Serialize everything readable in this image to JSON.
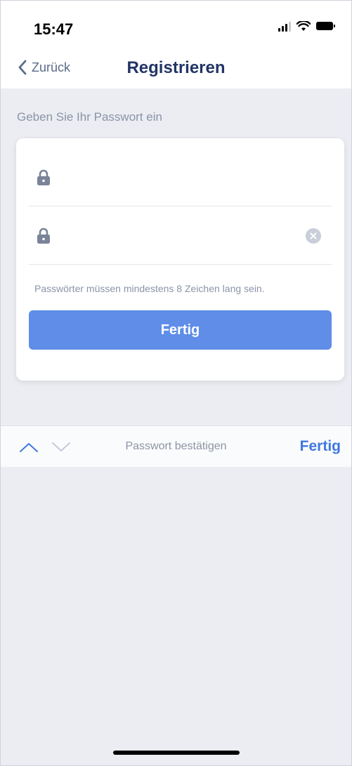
{
  "status_bar": {
    "time": "15:47"
  },
  "nav": {
    "back_label": "Zurück",
    "title": "Registrieren"
  },
  "form": {
    "section_label": "Geben Sie Ihr Passwort ein",
    "password_placeholder": "",
    "confirm_placeholder": "",
    "hint": "Passwörter müssen mindestens 8 Zeichen lang sein.",
    "submit_label": "Fertig"
  },
  "keyboard_accessory": {
    "title": "Passwort bestätigen",
    "done_label": "Fertig"
  },
  "colors": {
    "primary": "#5f8de8",
    "accent_link": "#3e78e0",
    "background": "#ebedf2",
    "title": "#233566"
  }
}
